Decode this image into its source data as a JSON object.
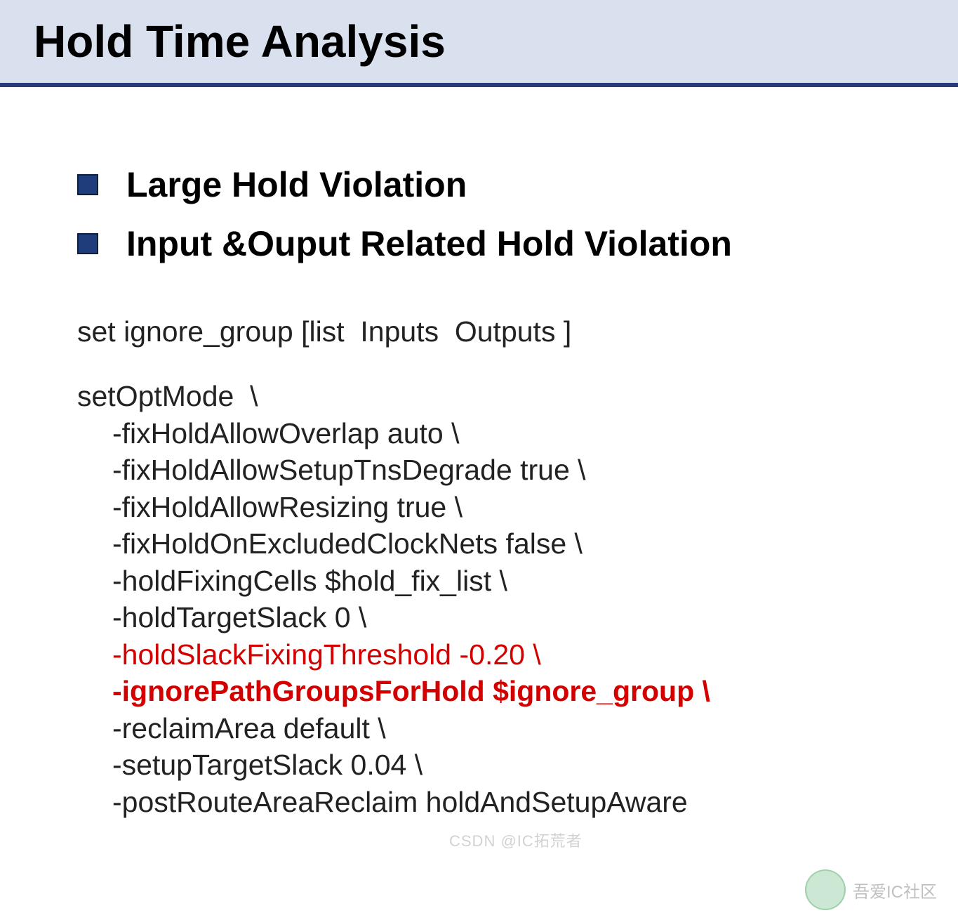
{
  "title": "Hold Time Analysis",
  "bullets": [
    "Large Hold Violation",
    "Input &Ouput Related Hold Violation"
  ],
  "code": {
    "set_line": "set ignore_group [list  Inputs  Outputs ]",
    "opt_head": "setOptMode  \\",
    "opts": [
      {
        "text": "-fixHoldAllowOverlap auto \\",
        "style": ""
      },
      {
        "text": "-fixHoldAllowSetupTnsDegrade true \\",
        "style": ""
      },
      {
        "text": "-fixHoldAllowResizing true \\",
        "style": ""
      },
      {
        "text": "-fixHoldOnExcludedClockNets false \\",
        "style": ""
      },
      {
        "text": "-holdFixingCells $hold_fix_list \\",
        "style": ""
      },
      {
        "text": "-holdTargetSlack 0 \\",
        "style": ""
      },
      {
        "text": "-holdSlackFixingThreshold -0.20 \\",
        "style": "red"
      },
      {
        "text": "-ignorePathGroupsForHold $ignore_group \\",
        "style": "redbold"
      },
      {
        "text": "-reclaimArea default \\",
        "style": ""
      },
      {
        "text": "-setupTargetSlack 0.04 \\",
        "style": ""
      },
      {
        "text": "-postRouteAreaReclaim holdAndSetupAware",
        "style": ""
      }
    ]
  },
  "watermark_center": "CSDN @IC拓荒者",
  "watermark_right": "吾爱IC社区"
}
